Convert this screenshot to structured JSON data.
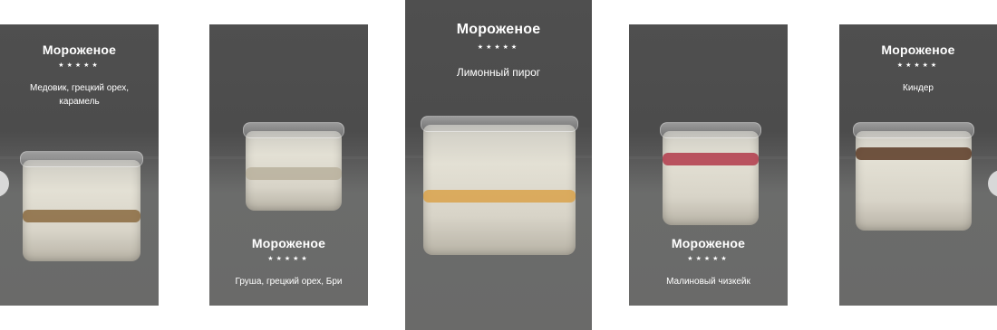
{
  "products": [
    {
      "title": "Мороженое",
      "stars": "★★★★★",
      "desc": "Медовик, грецкий орех, карамель",
      "swirl_color": "#8a6a3f"
    },
    {
      "title": "Мороженое",
      "stars": "★★★★★",
      "desc": "Груша, грецкий орех, Бри",
      "swirl_color": "#b8b09c"
    },
    {
      "title": "Мороженое",
      "stars": "★★★★★",
      "desc": "Лимонный пирог",
      "swirl_color": "#d9a24a"
    },
    {
      "title": "Мороженое",
      "stars": "★★★★★",
      "desc": "Малиновый чизкейк",
      "swirl_color": "#b23a4a"
    },
    {
      "title": "Мороженое",
      "stars": "★★★★★",
      "desc": "Киндер",
      "swirl_color": "#5a3a24"
    }
  ],
  "nav": {
    "prev_icon": "chevron-left-icon",
    "next_icon": "chevron-right-icon"
  },
  "colors": {
    "card_overlay": "#4f4f4f",
    "text": "#ffffff",
    "nav": "#d8d8d8",
    "background": "#ffffff"
  }
}
